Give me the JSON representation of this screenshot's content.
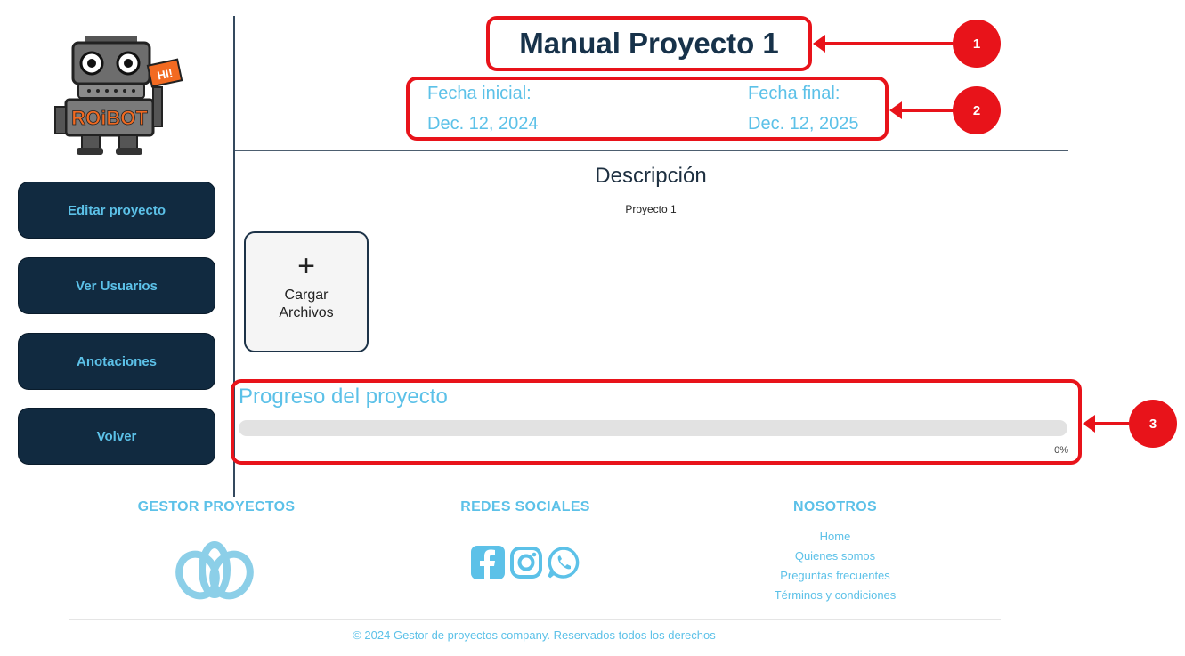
{
  "logo": {
    "label": "ROiBOT",
    "greeting": "HI!"
  },
  "sidebar": {
    "items": [
      {
        "label": "Editar proyecto"
      },
      {
        "label": "Ver Usuarios"
      },
      {
        "label": "Anotaciones"
      },
      {
        "label": "Volver"
      }
    ]
  },
  "header": {
    "title": "Manual Proyecto 1",
    "start_label": "Fecha inicial:",
    "start_date": "Dec. 12, 2024",
    "end_label": "Fecha final:",
    "end_date": "Dec. 12, 2025"
  },
  "description": {
    "heading": "Descripción",
    "text": "Proyecto 1"
  },
  "upload": {
    "icon": "+",
    "label": "Cargar Archivos"
  },
  "progress": {
    "title": "Progreso del proyecto",
    "value_percent": 0,
    "value_label": "0%"
  },
  "callouts": [
    "1",
    "2",
    "3"
  ],
  "footer": {
    "col1_title": "GESTOR PROYECTOS",
    "col2_title": "REDES SOCIALES",
    "col3_title": "NOSOTROS",
    "links": [
      "Home",
      "Quienes somos",
      "Preguntas frecuentes",
      "Términos y condiciones"
    ],
    "copyright": "© 2024 Gestor de proyectos company. Reservados todos los derechos"
  },
  "colors": {
    "accent": "#5cc1e8",
    "button_bg": "#112a40",
    "callout_red": "#e8131a",
    "title": "#17324a"
  },
  "icons": [
    "robot-logo-icon",
    "plus-icon",
    "lotus-logo-icon",
    "facebook-icon",
    "instagram-icon",
    "whatsapp-icon"
  ]
}
